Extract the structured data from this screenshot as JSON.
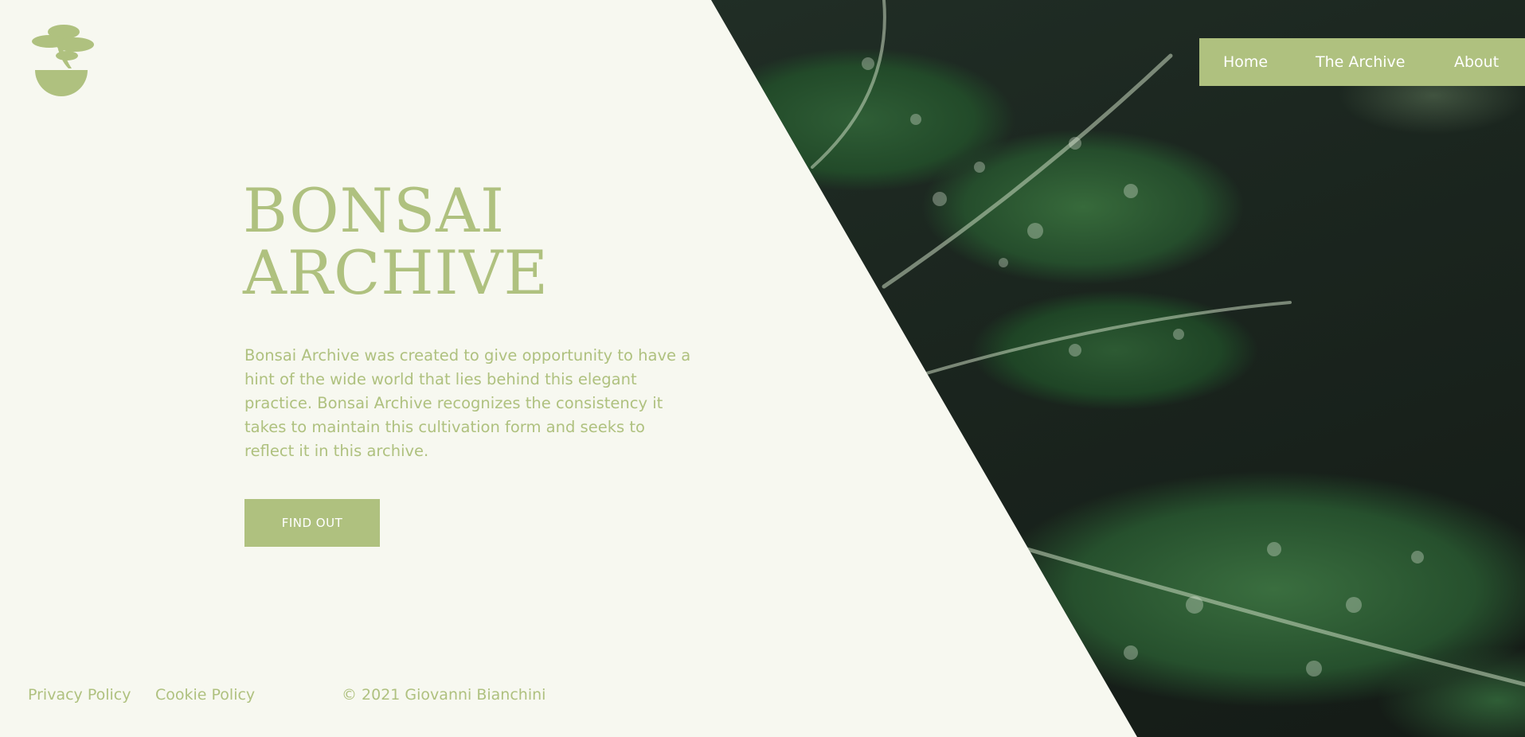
{
  "brand": {
    "logo_icon": "bonsai-tree-icon",
    "accent_color": "#afc17f"
  },
  "nav": {
    "items": [
      {
        "label": "Home"
      },
      {
        "label": "The Archive"
      },
      {
        "label": "About"
      }
    ]
  },
  "hero": {
    "title_line1": "BONSAI",
    "title_line2": "ARCHIVE",
    "description": "Bonsai Archive was created to give opportunity to have a hint of the wide world that lies behind this elegant practice. Bonsai Archive recognizes the consistency it takes to maintain this cultivation form and seeks to reflect it in this archive.",
    "cta_label": "FIND OUT"
  },
  "footer": {
    "privacy": "Privacy Policy",
    "cookie": "Cookie Policy",
    "copyright": "© 2021 Giovanni Bianchini"
  }
}
